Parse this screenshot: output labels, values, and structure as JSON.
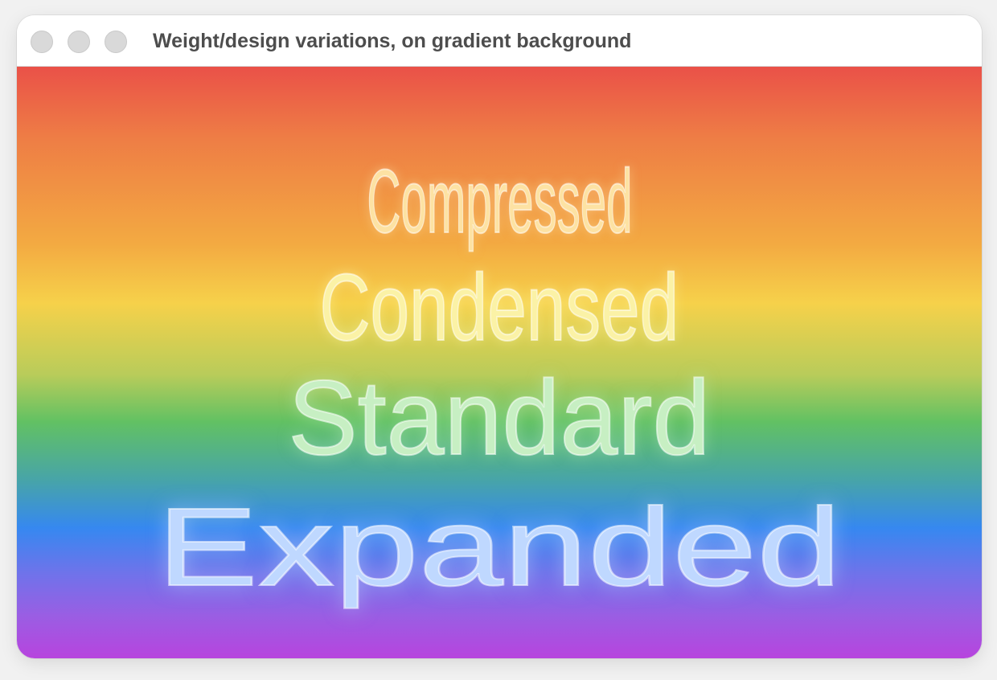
{
  "window": {
    "title": "Weight/design variations, on gradient background"
  },
  "controls": {
    "close": "close-button",
    "minimize": "minimize-button",
    "zoom": "zoom-button"
  },
  "content": {
    "background_colors": [
      "#ea5148",
      "#ee7d45",
      "#f3aa42",
      "#f6d14a",
      "#62c163",
      "#47a4a9",
      "#3688f0",
      "#7172ea",
      "#b744de"
    ],
    "words": [
      {
        "label": "Compressed",
        "color": "#fde2a3"
      },
      {
        "label": "Condensed",
        "color": "#fbf2a6"
      },
      {
        "label": "Standard",
        "color": "#c7efc3"
      },
      {
        "label": "Expanded",
        "color": "#bfd8ff"
      }
    ]
  }
}
